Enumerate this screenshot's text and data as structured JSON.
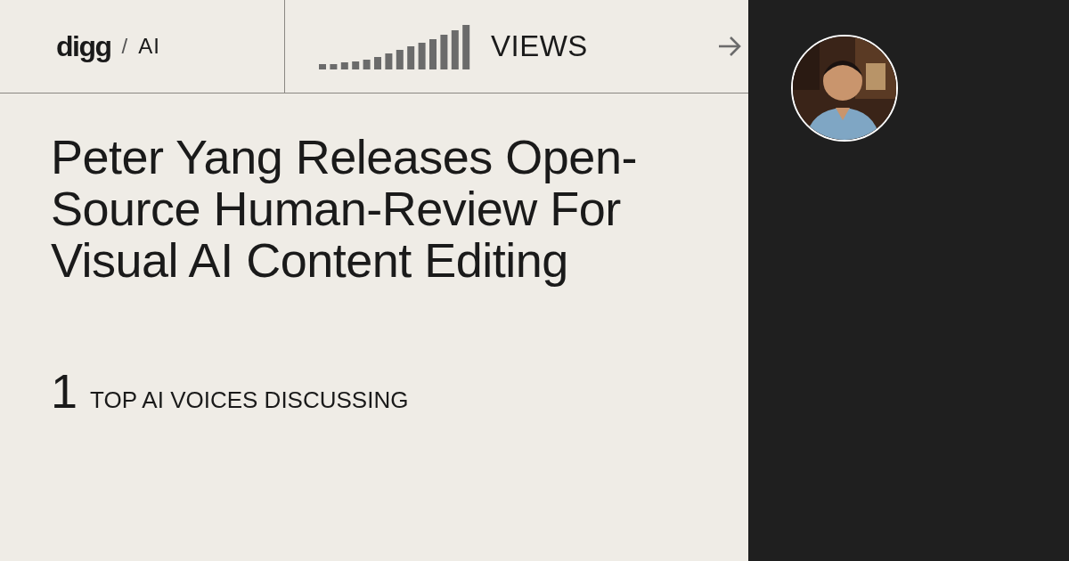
{
  "header": {
    "logo": "digg",
    "separator": "/",
    "section": "AI",
    "views_label": "VIEWS"
  },
  "headline": "Peter Yang Releases Open-Source Human-Review For Visual AI Content Editing",
  "voices": {
    "count": "1",
    "label": "TOP AI VOICES DISCUSSING"
  }
}
